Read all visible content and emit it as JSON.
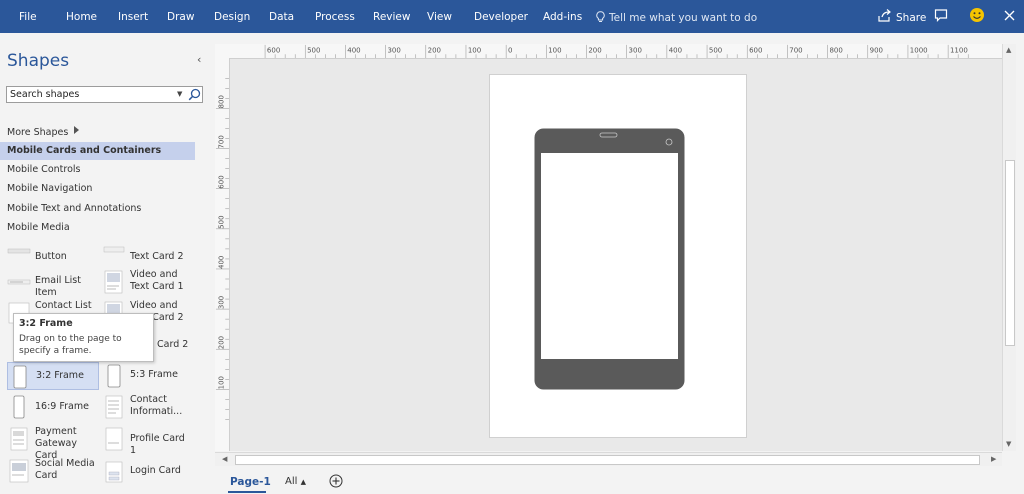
{
  "ribbon": {
    "tabs": [
      "File",
      "Home",
      "Insert",
      "Draw",
      "Design",
      "Data",
      "Process",
      "Review",
      "View",
      "Developer",
      "Add-ins"
    ],
    "tell_me": "Tell me what you want to do",
    "share": "Share",
    "colors": {
      "ribbon": "#2b579a"
    }
  },
  "shapes_pane": {
    "title": "Shapes",
    "search_placeholder": "Search shapes",
    "more_shapes": "More Shapes",
    "stencils": [
      {
        "label": "Mobile Cards and Containers",
        "active": true
      },
      {
        "label": "Mobile Controls",
        "active": false
      },
      {
        "label": "Mobile Navigation",
        "active": false
      },
      {
        "label": "Mobile Text and Annotations",
        "active": false
      },
      {
        "label": "Mobile Media",
        "active": false
      }
    ],
    "items": [
      {
        "label": "Button"
      },
      {
        "label": "Text Card 2"
      },
      {
        "label": "Email List Item"
      },
      {
        "label": "Video and Text Card 1"
      },
      {
        "label": "Contact List"
      },
      {
        "label": "Video and Text Card 2"
      },
      {
        "label": "Card 2"
      },
      {
        "label": "3:2 Frame",
        "selected": true
      },
      {
        "label": "5:3 Frame"
      },
      {
        "label": "16:9 Frame"
      },
      {
        "label": "Contact Informati..."
      },
      {
        "label": "Payment Gateway Card"
      },
      {
        "label": "Profile Card 1"
      },
      {
        "label": "Social Media Card"
      },
      {
        "label": "Login Card"
      }
    ],
    "tooltip": {
      "title": "3:2 Frame",
      "body": "Drag on to the page to specify a frame."
    }
  },
  "ruler": {
    "horizontal": [
      "600",
      "500",
      "400",
      "300",
      "200",
      "100",
      "0",
      "100",
      "200",
      "300",
      "400",
      "500",
      "600",
      "700",
      "800",
      "900",
      "1000",
      "1100"
    ],
    "vertical": [
      "800",
      "700",
      "600",
      "500",
      "400",
      "300",
      "200",
      "100"
    ]
  },
  "page_tabs": {
    "current": "Page-1",
    "all": "All"
  }
}
